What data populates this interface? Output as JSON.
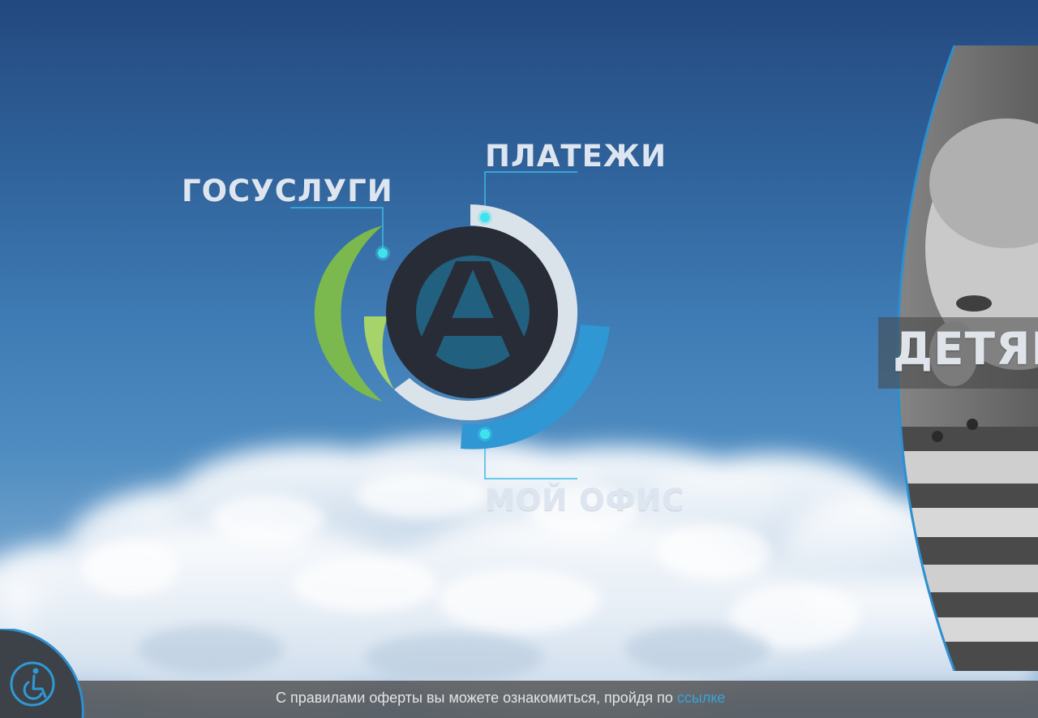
{
  "nav": {
    "gosuslugi": "ГОСУСЛУГИ",
    "platezhi": "ПЛАТЕЖИ",
    "moy_ofis": "МОЙ ОФИС"
  },
  "logo": {
    "letter": "A"
  },
  "promo": {
    "title": "ДЕТЯМ"
  },
  "footer": {
    "text": "С правилами оферты вы можете ознакомиться, пройдя по",
    "link": "ссылке"
  },
  "icons": {
    "accessibility": "wheelchair-icon",
    "logo": "logo-a-icon"
  },
  "colors": {
    "green": "#7bb84e",
    "light_green": "#a6d46a",
    "blue": "#2f97d3",
    "ring": "#dbe3ea",
    "logo_dark": "#272c36",
    "logo_teal": "#22607f",
    "dot": "#3fe3ee",
    "link": "#3aa3d8"
  }
}
